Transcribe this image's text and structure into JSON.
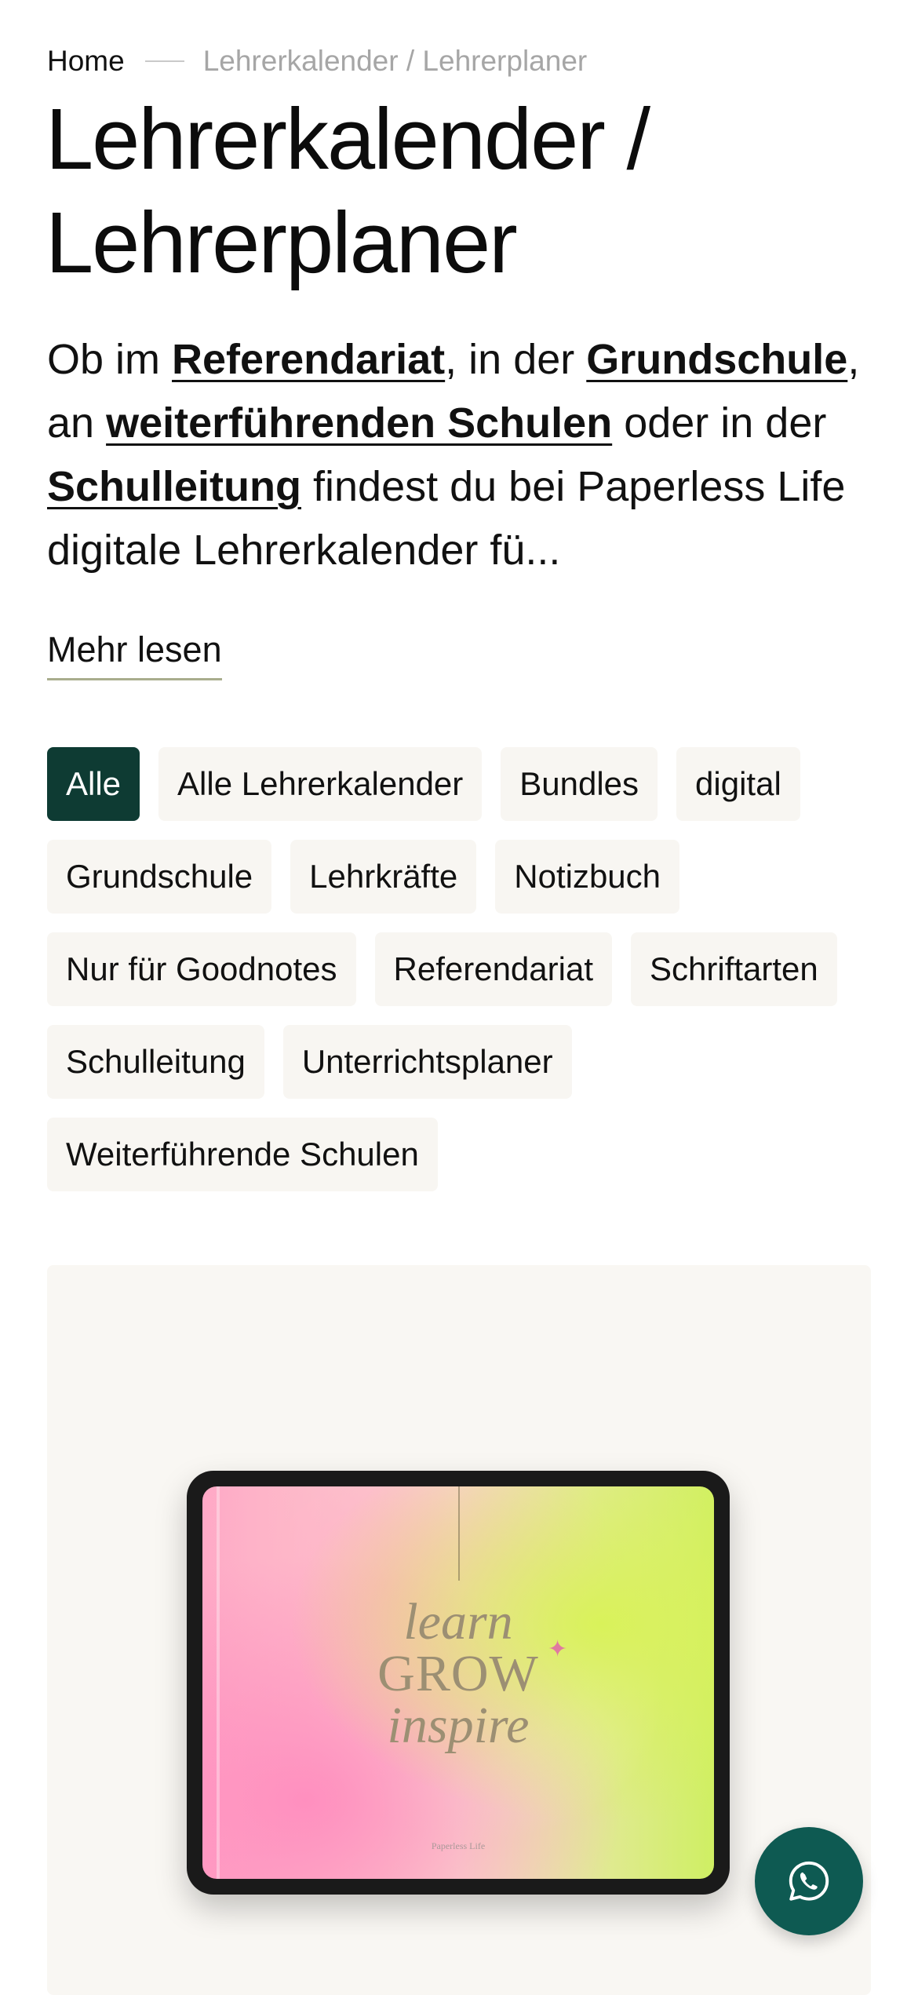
{
  "breadcrumb": {
    "home": "Home",
    "current": "Lehrerkalender / Lehrerplaner"
  },
  "title": "Lehrerkalender / Lehrerplaner",
  "intro": {
    "t1": "Ob im ",
    "link1": "Referendariat",
    "t2": ", in der ",
    "link2": "Grundschule",
    "t3": ", an ",
    "link3": "weiterführenden Schulen",
    "t4": " oder in der ",
    "link4": "Schulleitung",
    "t5": " findest du bei Paperless Life digitale Lehrerkalender fü..."
  },
  "read_more": "Mehr lesen",
  "filters": [
    "Alle",
    "Alle Lehrerkalender",
    "Bundles",
    "digital",
    "Grundschule",
    "Lehrkräfte",
    "Notizbuch",
    "Nur für Goodnotes",
    "Referendariat",
    "Schriftarten",
    "Schulleitung",
    "Unterrichtsplaner",
    "Weiterführende Schulen"
  ],
  "active_filter": "Alle",
  "product_image": {
    "line1": "learn",
    "line2": "GROW",
    "line3": "inspire",
    "brand": "Paperless Life"
  },
  "icons": {
    "whatsapp": "whatsapp-icon"
  },
  "colors": {
    "accent": "#0e3b33",
    "whatsapp": "#0e5a52",
    "chip_bg": "#f8f6f2"
  }
}
